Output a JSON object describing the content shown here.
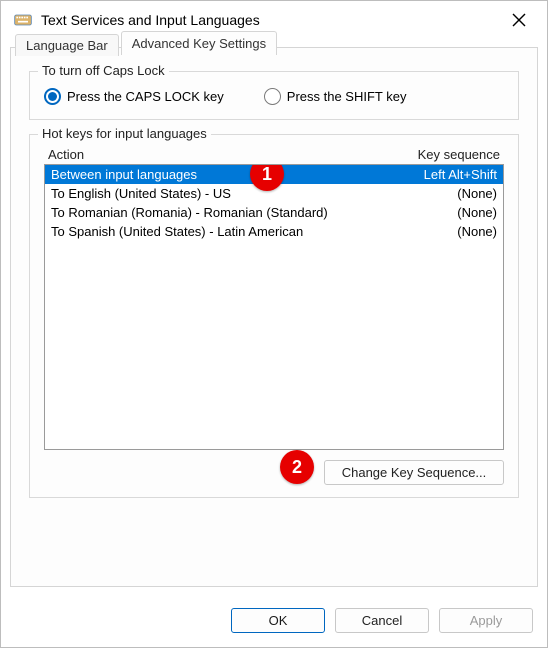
{
  "window": {
    "title": "Text Services and Input Languages"
  },
  "tabs": {
    "language_bar": "Language Bar",
    "advanced": "Advanced Key Settings"
  },
  "capslock": {
    "legend": "To turn off Caps Lock",
    "opt_caps": "Press the CAPS LOCK key",
    "opt_shift": "Press the SHIFT key"
  },
  "hotkeys": {
    "legend": "Hot keys for input languages",
    "header_action": "Action",
    "header_keyseq": "Key sequence",
    "rows": [
      {
        "action": "Between input languages",
        "keyseq": "Left Alt+Shift"
      },
      {
        "action": "To English (United States) - US",
        "keyseq": "(None)"
      },
      {
        "action": "To Romanian (Romania) - Romanian (Standard)",
        "keyseq": "(None)"
      },
      {
        "action": "To Spanish (United States) - Latin American",
        "keyseq": "(None)"
      }
    ],
    "change_btn": "Change Key Sequence..."
  },
  "buttons": {
    "ok": "OK",
    "cancel": "Cancel",
    "apply": "Apply"
  },
  "annotations": {
    "m1": "1",
    "m2": "2"
  }
}
